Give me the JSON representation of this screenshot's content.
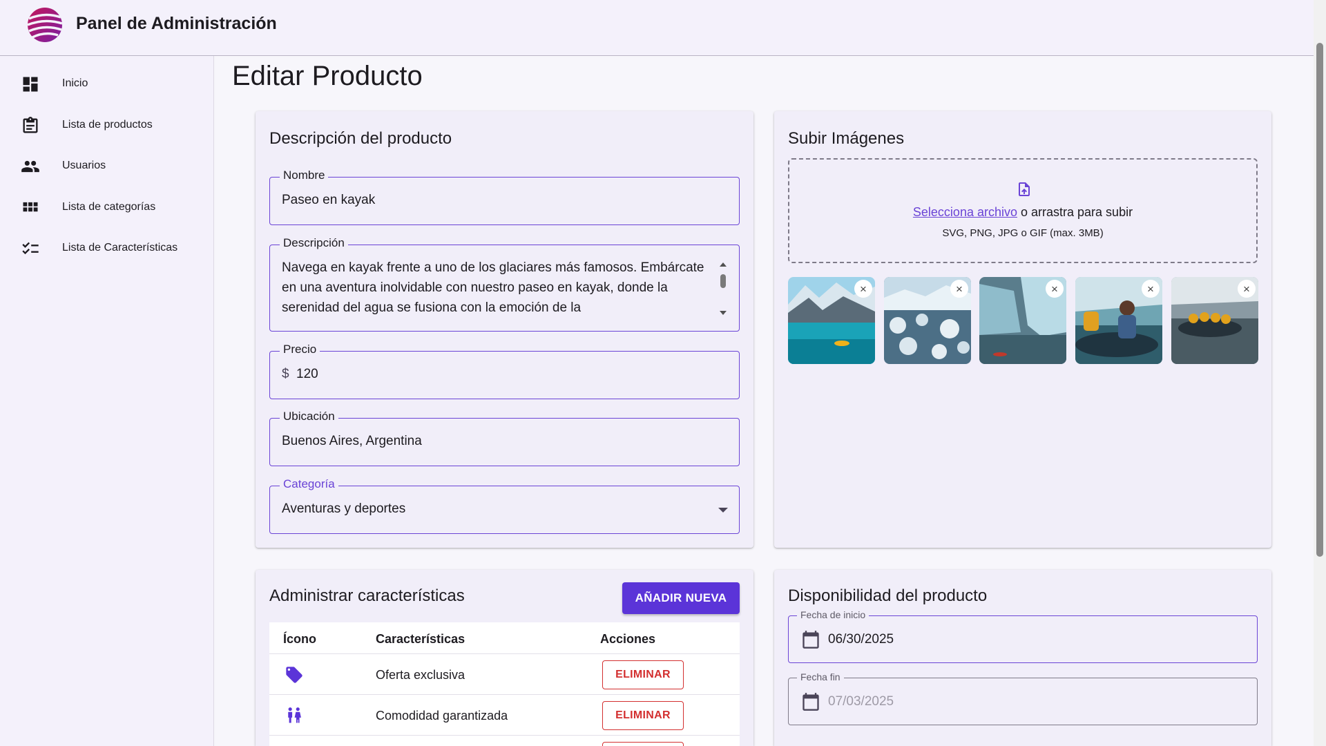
{
  "app": {
    "title": "Panel de Administración"
  },
  "sidebar": {
    "items": [
      {
        "label": "Inicio",
        "icon": "dashboard-icon"
      },
      {
        "label": "Lista de productos",
        "icon": "clipboard-icon"
      },
      {
        "label": "Usuarios",
        "icon": "people-icon"
      },
      {
        "label": "Lista de categorías",
        "icon": "grid-icon"
      },
      {
        "label": "Lista de Características",
        "icon": "checklist-icon"
      }
    ]
  },
  "page": {
    "title": "Editar Producto"
  },
  "product": {
    "card_title": "Descripción del producto",
    "name_label": "Nombre",
    "name_value": "Paseo en kayak",
    "description_label": "Descripción",
    "description_value": "Navega en kayak frente a uno de los glaciares más famosos. Embárcate en una aventura inolvidable con nuestro paseo en kayak, donde la serenidad del agua se fusiona con la emoción de la",
    "price_label": "Precio",
    "price_prefix": "$",
    "price_value": "120",
    "location_label": "Ubicación",
    "location_value": "Buenos Aires, Argentina",
    "category_label": "Categoría",
    "category_value": "Aventuras y deportes"
  },
  "upload": {
    "card_title": "Subir Imágenes",
    "link_text": "Selecciona archivo",
    "rest_text": " o arrastra para subir",
    "hint": "SVG, PNG, JPG o GIF (max. 3MB)",
    "close_glyph": "×"
  },
  "features": {
    "card_title": "Administrar características",
    "add_button": "AÑADIR NUEVA",
    "columns": [
      "Ícono",
      "Características",
      "Acciones"
    ],
    "rows": [
      {
        "icon": "tag-icon",
        "name": "Oferta exclusiva",
        "action": "ELIMINAR"
      },
      {
        "icon": "family-icon",
        "name": "Comodidad garantizada",
        "action": "ELIMINAR"
      }
    ]
  },
  "availability": {
    "card_title": "Disponibilidad del producto",
    "start_label": "Fecha de inicio",
    "start_value": "06/30/2025",
    "end_label": "Fecha fin",
    "end_value": "07/03/2025"
  },
  "colors": {
    "accent": "#5b34d8",
    "danger": "#d32f2f",
    "surface": "#f1eef9"
  }
}
